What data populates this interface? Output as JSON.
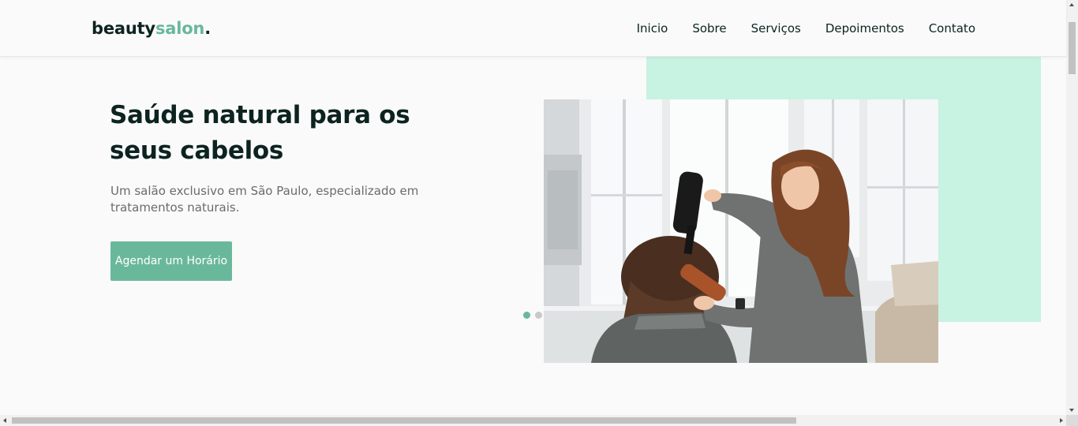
{
  "header": {
    "logo_main": "beauty",
    "logo_accent": "salon",
    "logo_dot": ".",
    "nav": [
      "Inicio",
      "Sobre",
      "Serviços",
      "Depoimentos",
      "Contato"
    ]
  },
  "hero": {
    "title": "Saúde natural para os seus cabelos",
    "text": "Um salão exclusivo em São Paulo, especializado em tratamentos naturais.",
    "cta_label": "Agendar um Horário",
    "carousel_active_slide": 1,
    "carousel_slide_count": 2
  },
  "colors": {
    "accent": "#6ab89c",
    "mint_background": "#c8f2e2",
    "dark_text": "#0c2320",
    "muted_text": "#6b6b6b"
  }
}
